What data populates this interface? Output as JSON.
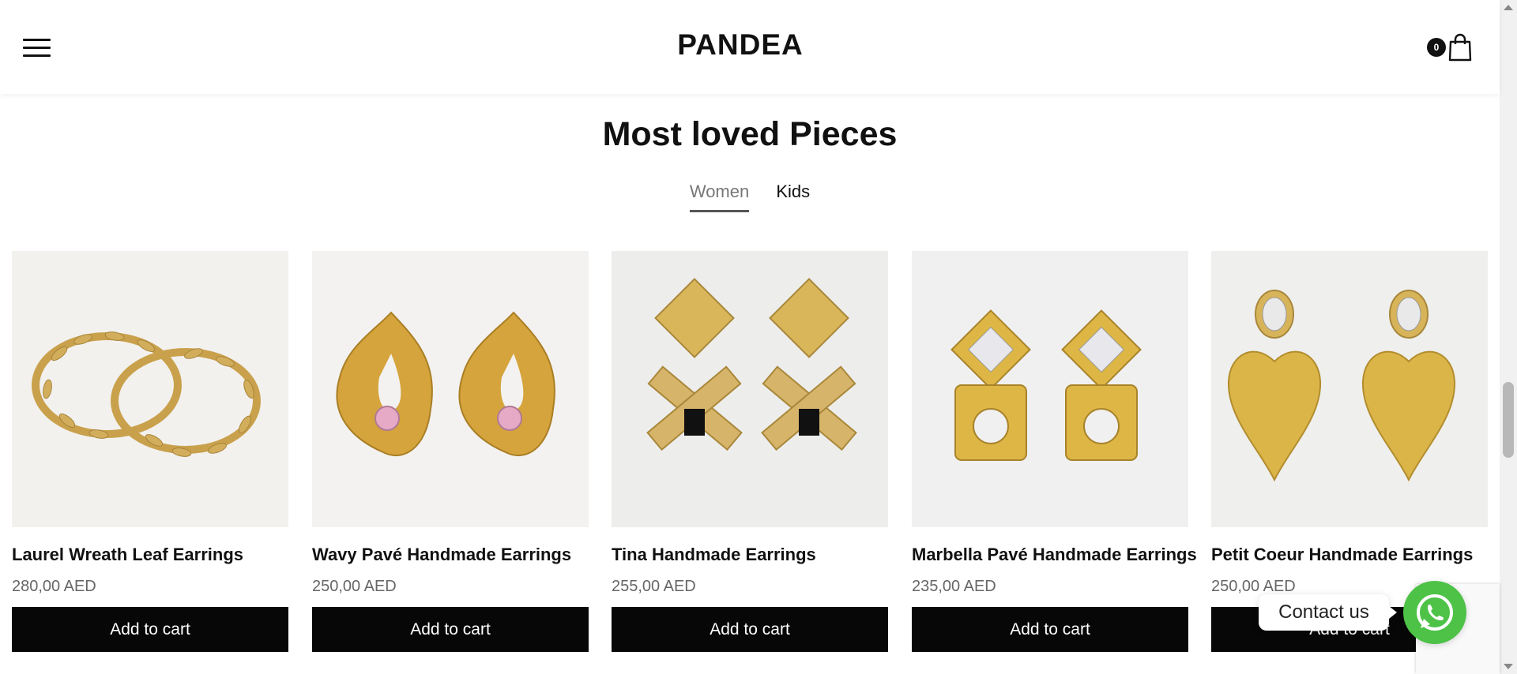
{
  "header": {
    "logo": "PANDEA",
    "cart_count": "0"
  },
  "section": {
    "title": "Most loved Pieces",
    "tabs": [
      {
        "label": "Women",
        "active": true
      },
      {
        "label": "Kids",
        "active": false
      }
    ]
  },
  "products": [
    {
      "title": "Laurel Wreath Leaf Earrings",
      "price": "280,00 AED",
      "button": "Add to cart"
    },
    {
      "title": "Wavy Pavé Handmade Earrings",
      "price": "250,00 AED",
      "button": "Add to cart"
    },
    {
      "title": "Tina Handmade Earrings",
      "price": "255,00 AED",
      "button": "Add to cart"
    },
    {
      "title": "Marbella Pavé Handmade Earrings",
      "price": "235,00 AED",
      "button": "Add to cart"
    },
    {
      "title": "Petit Coeur Handmade Earrings",
      "price": "250,00 AED",
      "button": "Add to cart"
    }
  ],
  "contact": {
    "label": "Contact us"
  },
  "colors": {
    "button_bg": "#070707",
    "whatsapp": "#4dc247",
    "gold": "#d4a93f"
  }
}
